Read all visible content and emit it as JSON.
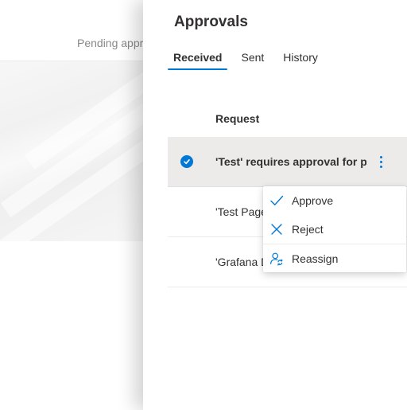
{
  "background": {
    "pending_text": "Pending appr"
  },
  "panel": {
    "title": "Approvals",
    "tabs": [
      {
        "label": "Received",
        "active": true
      },
      {
        "label": "Sent",
        "active": false
      },
      {
        "label": "History",
        "active": false
      }
    ],
    "column_header": "Request",
    "rows": [
      {
        "text": "'Test' requires approval for pu",
        "selected": true
      },
      {
        "text": "'Test Page",
        "selected": false
      },
      {
        "text": "'Grafana D",
        "selected": false
      }
    ]
  },
  "context_menu": {
    "items": [
      {
        "label": "Approve",
        "icon": "checkmark-icon"
      },
      {
        "label": "Reject",
        "icon": "x-icon"
      },
      {
        "label": "Reassign",
        "icon": "person-sync-icon"
      }
    ]
  },
  "colors": {
    "accent": "#0078d4",
    "text": "#323130",
    "selected_row": "#edebe9"
  }
}
